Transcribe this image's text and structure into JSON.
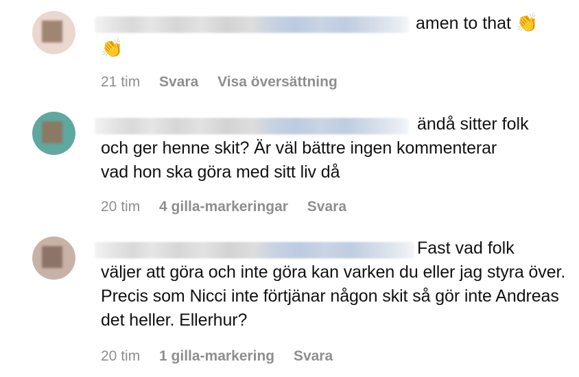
{
  "comments": [
    {
      "first_line": "amen to that",
      "emoji_inline": "👏",
      "wrapped_text": "👏",
      "time": "21 tim",
      "likes": "",
      "reply": "Svara",
      "translate": "Visa översättning"
    },
    {
      "first_line": "ändå sitter folk",
      "wrapped_text": "och ger henne skit? Är väl bättre ingen kommenterar vad hon ska göra med sitt liv då",
      "time": "20 tim",
      "likes": "4 gilla-markeringar",
      "reply": "Svara"
    },
    {
      "first_line": "Fast vad folk",
      "wrapped_text": "väljer att göra och inte göra kan varken du eller jag styra över. Precis som Nicci inte förtjänar någon skit så gör inte Andreas det heller. Ellerhur?",
      "time": "20 tim",
      "likes": "1 gilla-markering",
      "reply": "Svara"
    }
  ],
  "colors": {
    "meta_text": "#8e8e8e",
    "body_text": "#111111",
    "background": "#ffffff"
  },
  "icons": [
    "clapping-hands-emoji"
  ]
}
